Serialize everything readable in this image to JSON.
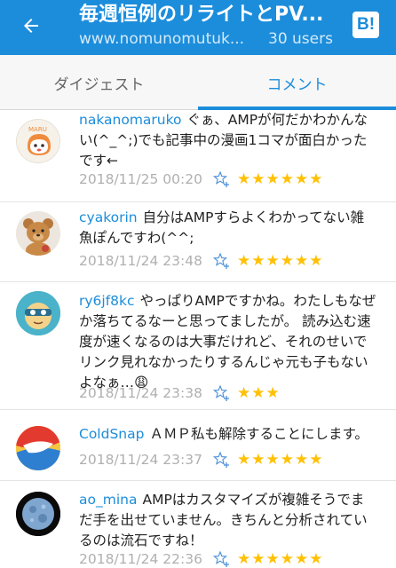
{
  "header": {
    "title": "毎週恒例のリライトとPV...",
    "url": "www.nomunomutuk...",
    "users": "30 users",
    "badge": "B!"
  },
  "tabs": [
    {
      "label": "ダイジェスト"
    },
    {
      "label": "コメント"
    }
  ],
  "comments": [
    {
      "user": "nakanomaruko",
      "text": "ぐぁ、AMPが何だかわかんない(^_^;)でも記事中の漫画1コマが面白かったです←",
      "date": "2018/11/25 00:20",
      "stars": "★★★★★★",
      "star_count": 6
    },
    {
      "user": "cyakorin",
      "text": "自分はAMPすらよくわかってない雑魚ぽんですわ(^^;",
      "date": "2018/11/24 23:48",
      "stars": "★★★★★★",
      "star_count": 6
    },
    {
      "user": "ry6jf8kc",
      "text": "やっぱりAMPですかね。わたしもなぜか落ちてるなーと思ってましたが。 読み込む速度が速くなるのは大事だけれど、それのせいでリンク見れなかったりするんじゃ元も子もないよなぁ…😩",
      "date": "2018/11/24 23:38",
      "stars": "★★★",
      "star_count": 3
    },
    {
      "user": "ColdSnap",
      "text": "ＡＭＰ私も解除することにします。",
      "date": "2018/11/24 23:37",
      "stars": "★★★★★★",
      "star_count": 6
    },
    {
      "user": "ao_mina",
      "text": "AMPはカスタマイズが複雑そうでまだ手を出せていません。きちんと分析されているのは流石ですね！",
      "date": "2018/11/24 22:36",
      "stars": "★★★★★★",
      "star_count": 6
    }
  ],
  "colors": {
    "accent": "#1c8ddb",
    "star": "#ffc107",
    "muted": "#b0b0b0"
  },
  "icons": {
    "back": "arrow-left-icon",
    "add_star": "add-star-icon"
  }
}
